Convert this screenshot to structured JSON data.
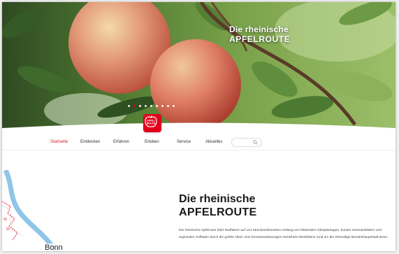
{
  "hero": {
    "title_line1": "Die rheinische",
    "title_line2": "APFELROUTE",
    "slides": [
      false,
      true,
      false,
      false,
      false,
      false,
      false,
      false,
      false
    ]
  },
  "logo": {
    "text_top": "APFEL",
    "text_bottom": "ROUTE",
    "color": "#e3001b"
  },
  "nav": {
    "items": [
      {
        "label": "Startseite",
        "active": true
      },
      {
        "label": "Entdecken",
        "active": false
      },
      {
        "label": "Erfahren",
        "active": false
      },
      {
        "label": "Erleben",
        "active": false
      },
      {
        "label": "Service",
        "active": false
      },
      {
        "label": "Aktuelles",
        "active": false
      }
    ],
    "search_icon": "search-icon",
    "active_color": "#d61f26"
  },
  "map": {
    "city_label": "Bonn",
    "river_color": "#8ec5e8",
    "route_color": "#e3001b"
  },
  "content": {
    "title_line1": "Die rheinische",
    "title_line2": "APFELROUTE",
    "text": "Die rheinische Apfelroute führt Radfahrer auf 124 Streckenkilometern entlang von blühenden Obstplantagen, bunten Gemüsefeldern und regionalen Hofläden durch die größte Obst- und Gemüseanbauregion Nordrhein-Westfalens rund um die ehemalige Bundeshauptstadt Bonn."
  }
}
